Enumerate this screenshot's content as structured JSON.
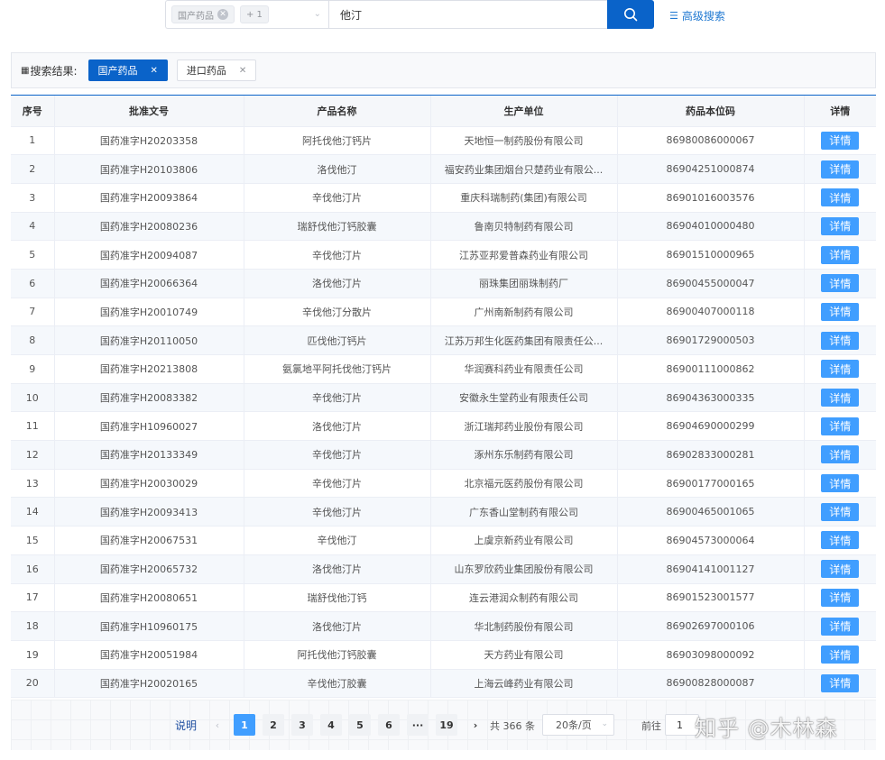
{
  "search": {
    "type_chip": "国产药品",
    "more_chip": "+ 1",
    "keyword": "他汀",
    "advanced_label": "高级搜索"
  },
  "results": {
    "label": "搜索结果:",
    "tags": [
      "国产药品",
      "进口药品"
    ]
  },
  "table": {
    "headers": [
      "序号",
      "批准文号",
      "产品名称",
      "生产单位",
      "药品本位码",
      "详情"
    ],
    "detail_label": "详情",
    "rows": [
      [
        "1",
        "国药准字H20203358",
        "阿托伐他汀钙片",
        "天地恒一制药股份有限公司",
        "86980086000067"
      ],
      [
        "2",
        "国药准字H20103806",
        "洛伐他汀",
        "福安药业集团烟台只楚药业有限公...",
        "86904251000874"
      ],
      [
        "3",
        "国药准字H20093864",
        "辛伐他汀片",
        "重庆科瑞制药(集团)有限公司",
        "86901016003576"
      ],
      [
        "4",
        "国药准字H20080236",
        "瑞舒伐他汀钙胶囊",
        "鲁南贝特制药有限公司",
        "86904010000480"
      ],
      [
        "5",
        "国药准字H20094087",
        "辛伐他汀片",
        "江苏亚邦爱普森药业有限公司",
        "86901510000965"
      ],
      [
        "6",
        "国药准字H20066364",
        "洛伐他汀片",
        "丽珠集团丽珠制药厂",
        "86900455000047"
      ],
      [
        "7",
        "国药准字H20010749",
        "辛伐他汀分散片",
        "广州南新制药有限公司",
        "86900407000118"
      ],
      [
        "8",
        "国药准字H20110050",
        "匹伐他汀钙片",
        "江苏万邦生化医药集团有限责任公...",
        "86901729000503"
      ],
      [
        "9",
        "国药准字H20213808",
        "氨氯地平阿托伐他汀钙片",
        "华润赛科药业有限责任公司",
        "86900111000862"
      ],
      [
        "10",
        "国药准字H20083382",
        "辛伐他汀片",
        "安徽永生堂药业有限责任公司",
        "86904363000335"
      ],
      [
        "11",
        "国药准字H10960027",
        "洛伐他汀片",
        "浙江瑞邦药业股份有限公司",
        "86904690000299"
      ],
      [
        "12",
        "国药准字H20133349",
        "辛伐他汀片",
        "涿州东乐制药有限公司",
        "86902833000281"
      ],
      [
        "13",
        "国药准字H20030029",
        "辛伐他汀片",
        "北京福元医药股份有限公司",
        "86900177000165"
      ],
      [
        "14",
        "国药准字H20093413",
        "辛伐他汀片",
        "广东香山堂制药有限公司",
        "86900465001065"
      ],
      [
        "15",
        "国药准字H20067531",
        "辛伐他汀",
        "上虞京新药业有限公司",
        "86904573000064"
      ],
      [
        "16",
        "国药准字H20065732",
        "洛伐他汀片",
        "山东罗欣药业集团股份有限公司",
        "86904141001127"
      ],
      [
        "17",
        "国药准字H20080651",
        "瑞舒伐他汀钙",
        "连云港润众制药有限公司",
        "86901523001577"
      ],
      [
        "18",
        "国药准字H10960175",
        "洛伐他汀片",
        "华北制药股份有限公司",
        "86902697000106"
      ],
      [
        "19",
        "国药准字H20051984",
        "阿托伐他汀钙胶囊",
        "天方药业有限公司",
        "86903098000092"
      ],
      [
        "20",
        "国药准字H20020165",
        "辛伐他汀胶囊",
        "上海云峰药业有限公司",
        "86900828000087"
      ]
    ]
  },
  "pagination": {
    "explain": "说明",
    "prev": "‹",
    "next": "›",
    "pages": [
      "1",
      "2",
      "3",
      "4",
      "5",
      "6",
      "···",
      "19"
    ],
    "current": "1",
    "total": "共 366 条",
    "page_size": "20条/页",
    "goto_label": "前往",
    "goto_value": "1"
  },
  "watermark": "知乎 @木林森"
}
